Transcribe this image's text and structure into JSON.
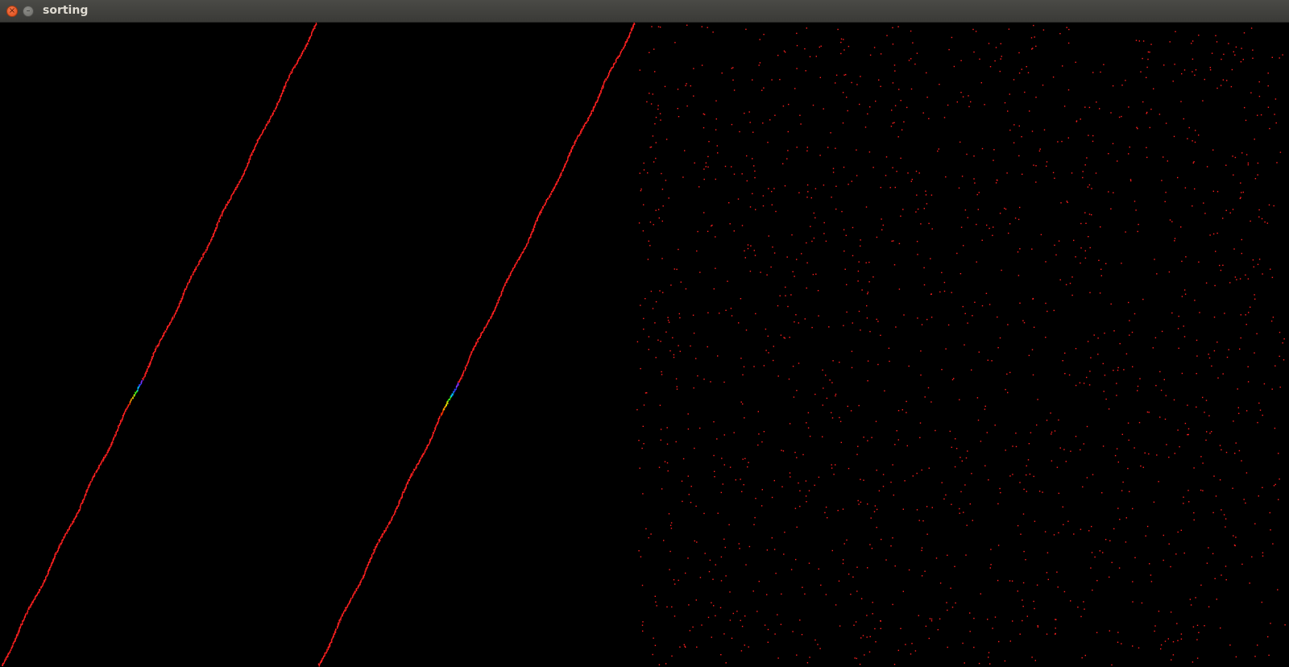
{
  "window": {
    "title": "sorting",
    "close_icon": "close-icon",
    "minimize_icon": "minimize-icon"
  },
  "visualization": {
    "background_color": "#000000",
    "point_color": "#ff2020",
    "highlight_colors": [
      "#ff3000",
      "#ffa000",
      "#e0e000",
      "#40ff20",
      "#00c0ff",
      "#3040ff",
      "#8030ff"
    ],
    "panels": [
      {
        "name": "partially-sorted-panel-1",
        "state": "sorted-diagonal"
      },
      {
        "name": "partially-sorted-panel-2",
        "state": "sorted-diagonal"
      },
      {
        "name": "unsorted-panel",
        "state": "random-scatter"
      }
    ]
  }
}
